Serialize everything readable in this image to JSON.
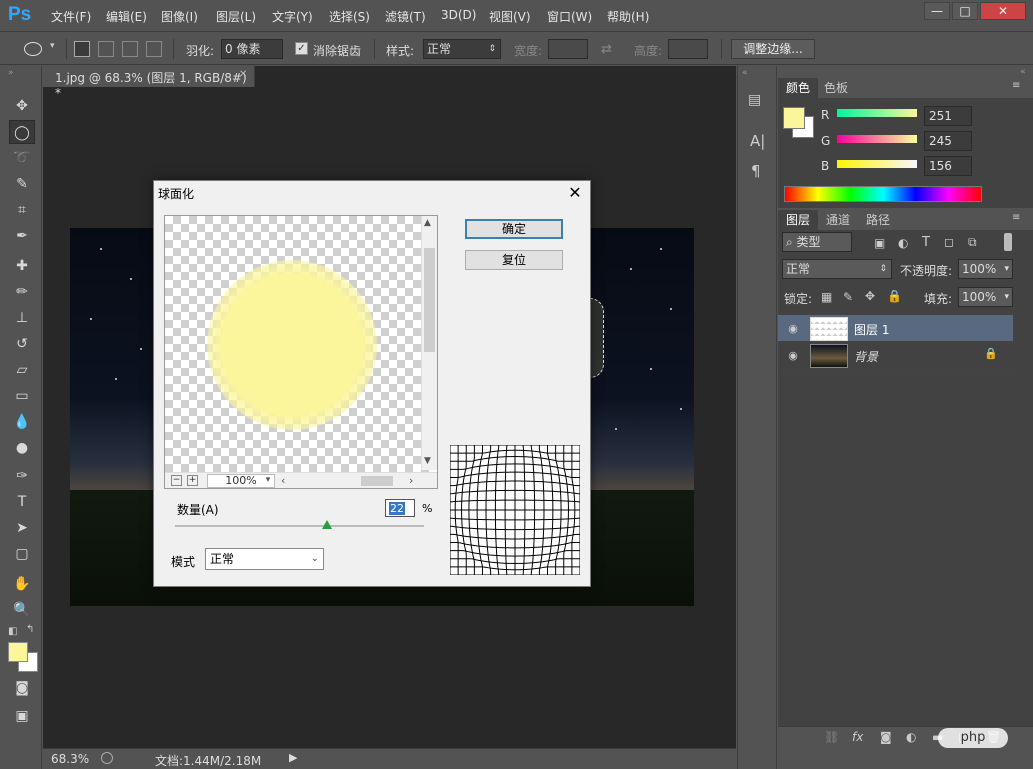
{
  "app": {
    "logo": "Ps"
  },
  "menu": {
    "items": [
      "文件(F)",
      "编辑(E)",
      "图像(I)",
      "图层(L)",
      "文字(Y)",
      "选择(S)",
      "滤镜(T)",
      "3D(D)",
      "视图(V)",
      "窗口(W)",
      "帮助(H)"
    ]
  },
  "window_controls": {
    "minimize": "—",
    "maximize": "□",
    "close": "✕"
  },
  "options": {
    "feather_label": "羽化:",
    "feather_value": "0 像素",
    "antialias_label": "消除锯齿",
    "antialias_checked": true,
    "style_label": "样式:",
    "style_value": "正常",
    "width_label": "宽度:",
    "height_label": "高度:",
    "refine_edge_button": "调整边缘..."
  },
  "document": {
    "tab_title": "1.jpg @ 68.3% (图层 1, RGB/8#) *",
    "close": "✕"
  },
  "status": {
    "zoom": "68.3%",
    "doc_info": "文档:1.44M/2.18M"
  },
  "color_panel": {
    "tabs": [
      "颜色",
      "色板"
    ],
    "foreground": "#fbf59c",
    "background": "#ffffff",
    "channels": [
      {
        "label": "R",
        "value": "251"
      },
      {
        "label": "G",
        "value": "245"
      },
      {
        "label": "B",
        "value": "156"
      }
    ]
  },
  "layers_panel": {
    "tabs": [
      "图层",
      "通道",
      "路径"
    ],
    "filter_kind": "类型",
    "blend_mode": "正常",
    "opacity_label": "不透明度:",
    "opacity_value": "100%",
    "lock_label": "锁定:",
    "fill_label": "填充:",
    "fill_value": "100%",
    "layers": [
      {
        "name": "图层 1",
        "selected": true
      },
      {
        "name": "背景",
        "locked": true
      }
    ]
  },
  "dialog": {
    "title": "球面化",
    "ok_button": "确定",
    "reset_button": "复位",
    "zoom_value": "100%",
    "amount_label": "数量(A)",
    "amount_value": "22",
    "amount_unit": "%",
    "amount_fraction": 0.61,
    "mode_label": "模式",
    "mode_value": "正常"
  },
  "watermark": "php"
}
